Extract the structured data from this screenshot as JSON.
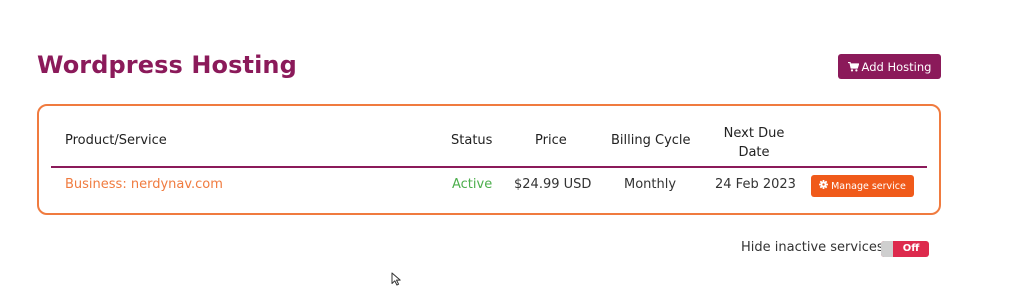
{
  "page": {
    "title": "Wordpress Hosting",
    "add_button_label": "Add Hosting"
  },
  "table": {
    "headers": {
      "product": "Product/Service",
      "status": "Status",
      "price": "Price",
      "billing_cycle": "Billing Cycle",
      "next_due_line1": "Next Due",
      "next_due_line2": "Date"
    },
    "rows": [
      {
        "product": "Business: nerdynav.com",
        "status": "Active",
        "price": "$24.99 USD",
        "billing_cycle": "Monthly",
        "next_due": "24 Feb 2023",
        "action_label": "Manage service"
      }
    ]
  },
  "filter": {
    "hide_inactive_label": "Hide inactive services",
    "toggle_state": "Off"
  },
  "colors": {
    "brand": "#8b1a5a",
    "accent": "#f07b3f",
    "action": "#f05a1a",
    "active_status": "#4cae4c",
    "toggle_off": "#dd2a4d"
  },
  "icons": {
    "add_button": "cart-icon",
    "manage_button": "gear-icon"
  }
}
